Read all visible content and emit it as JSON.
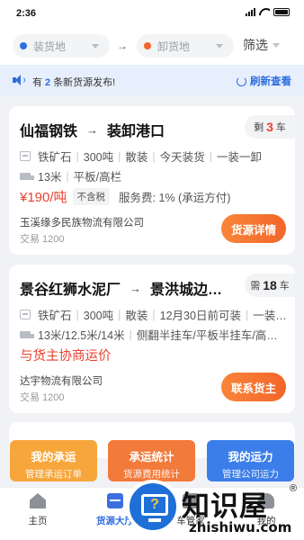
{
  "status_bar": {
    "time": "2:36"
  },
  "filter": {
    "load_placeholder": "装货地",
    "unload_placeholder": "卸货地",
    "arrow": "→",
    "filter_label": "筛选",
    "load_dot_color": "#2f6fe0",
    "unload_dot_color": "#f2662a"
  },
  "notice": {
    "prefix": "有",
    "count": "2",
    "suffix": "条新货源发布!",
    "refresh_label": "刷新查看"
  },
  "cards": [
    {
      "from": "仙福钢铁",
      "arrow": "→",
      "to": "装卸港口",
      "remain_prefix": "剩",
      "remain_count": "3",
      "remain_unit": "车",
      "goods": [
        "铁矿石",
        "300吨",
        "散装",
        "今天装货",
        "一装一卸"
      ],
      "truck": [
        "13米",
        "平板/高栏"
      ],
      "price": "¥190/吨",
      "tax_tag": "不含税",
      "service_fee": "服务费: 1% (承运方付)",
      "company": "玉溪缘多民族物流有限公司",
      "trades": "交易 1200",
      "action": "货源详情"
    },
    {
      "from": "景谷红狮水泥厂",
      "arrow": "→",
      "to": "景洪城边…",
      "remain_prefix": "需",
      "remain_count": "18",
      "remain_unit": "车",
      "goods": [
        "铁矿石",
        "300吨",
        "散装",
        "12月30日前可装",
        "一装…"
      ],
      "truck": [
        "13米/12.5米/14米",
        "侧翻半挂车/平板半挂车/高…"
      ],
      "negotiate": "与货主协商运价",
      "company": "达宇物流有限公司",
      "trades": "交易 1200",
      "action": "联系货主"
    }
  ],
  "quick_actions": [
    {
      "title": "我的承运",
      "subtitle": "管理承运订单"
    },
    {
      "title": "承运统计",
      "subtitle": "货源费用统计"
    },
    {
      "title": "我的运力",
      "subtitle": "管理公司运力"
    }
  ],
  "tabs": [
    {
      "label": "主页"
    },
    {
      "label": "货源大厅"
    },
    {
      "label": "车管家"
    },
    {
      "label": "我的"
    }
  ],
  "watermark": {
    "cn": "知识屋",
    "en": "zhishiwu.com",
    "reg": "®"
  }
}
